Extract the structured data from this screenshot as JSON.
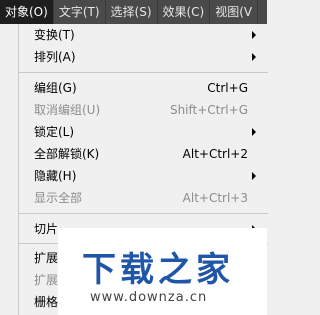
{
  "menubar": {
    "items": [
      {
        "label": "对象(O)",
        "active": true
      },
      {
        "label": "文字(T)"
      },
      {
        "label": "选择(S)"
      },
      {
        "label": "效果(C)"
      },
      {
        "label": "视图(V"
      }
    ]
  },
  "menu": {
    "items": [
      {
        "label": "变换(T)",
        "shortcut": "",
        "submenu": true,
        "disabled": false
      },
      {
        "label": "排列(A)",
        "shortcut": "",
        "submenu": true,
        "disabled": false
      },
      {
        "label": "编组(G)",
        "shortcut": "Ctrl+G",
        "submenu": false,
        "disabled": false
      },
      {
        "label": "取消编组(U)",
        "shortcut": "Shift+Ctrl+G",
        "submenu": false,
        "disabled": true
      },
      {
        "label": "锁定(L)",
        "shortcut": "",
        "submenu": true,
        "disabled": false
      },
      {
        "label": "全部解锁(K)",
        "shortcut": "Alt+Ctrl+2",
        "submenu": false,
        "disabled": false
      },
      {
        "label": "隐藏(H)",
        "shortcut": "",
        "submenu": true,
        "disabled": false
      },
      {
        "label": "显示全部",
        "shortcut": "Alt+Ctrl+3",
        "submenu": false,
        "disabled": true
      },
      {
        "label": "切片",
        "shortcut": "",
        "submenu": true,
        "disabled": false
      },
      {
        "label": "扩展",
        "shortcut": "",
        "submenu": false,
        "disabled": false
      },
      {
        "label": "扩展",
        "shortcut": "",
        "submenu": false,
        "disabled": true
      },
      {
        "label": "栅格",
        "shortcut": "",
        "submenu": false,
        "disabled": false
      }
    ]
  },
  "watermark": {
    "title": "下载之家",
    "url": "www.downza.cn"
  }
}
